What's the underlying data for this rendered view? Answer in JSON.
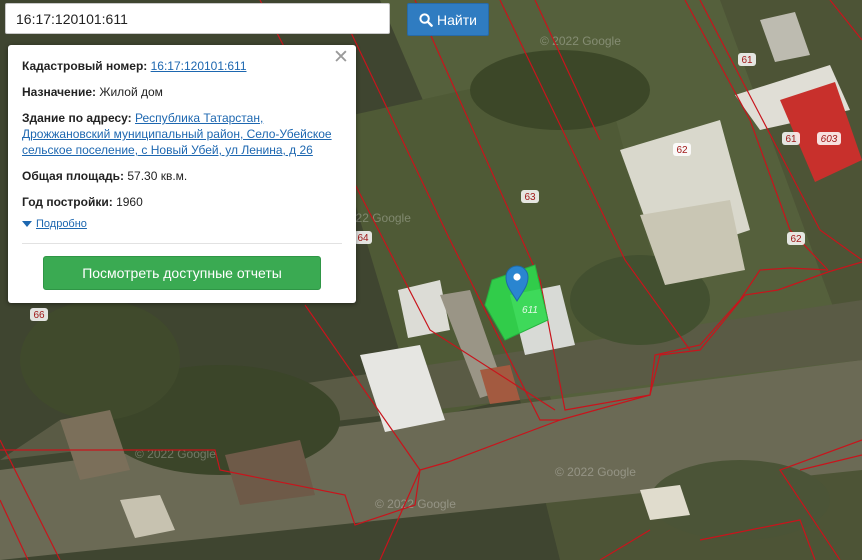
{
  "search": {
    "value": "16:17:120101:611",
    "button_label": "Найти",
    "icon": "search-icon"
  },
  "popup": {
    "cadastral_label": "Кадастровый номер:",
    "cadastral_value": "16:17:120101:611",
    "purpose_label": "Назначение:",
    "purpose_value": "Жилой дом",
    "address_label": "Здание по адресу:",
    "address_value": "Республика Татарстан, Дрожжановский муниципальный район, Село-Убейское сельское поселение, с Новый Убей, ул Ленина, д 26",
    "area_label": "Общая площадь:",
    "area_value": "57.30 кв.м.",
    "year_label": "Год постройки:",
    "year_value": "1960",
    "details_label": "Подробно",
    "report_button": "Посмотреть доступные отчеты",
    "close_icon": "close-icon"
  },
  "map": {
    "watermark": "© 2022 Google",
    "parcel_labels": [
      "61",
      "603",
      "61",
      "62",
      "62",
      "63",
      "64",
      "66",
      "611"
    ],
    "boundary_color": "#c8141c",
    "selected_color": "#2ed84c",
    "marker_color": "#2a85d0",
    "marker_icon": "map-pin-icon"
  }
}
